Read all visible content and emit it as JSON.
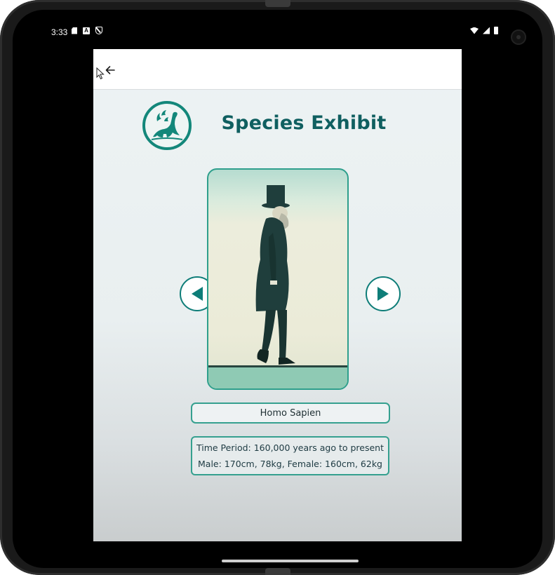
{
  "status_bar": {
    "time": "3:33",
    "left_icons": [
      "sim-card-icon",
      "a-notification-icon",
      "shield-icon"
    ],
    "right_icons": [
      "wifi-icon",
      "signal-icon",
      "battery-icon"
    ]
  },
  "app_bar": {
    "back_icon": "arrow-left-icon"
  },
  "header": {
    "logo": "dinosaur-logo-icon",
    "title": "Species Exhibit"
  },
  "exhibit": {
    "image": "walking-man-with-top-hat-illustration",
    "prev_icon": "triangle-left-icon",
    "next_icon": "triangle-right-icon",
    "species_name": "Homo Sapien",
    "time_period": "Time Period: 160,000 years ago to present",
    "size_info": "Male: 170cm, 78kg, Female: 160cm, 62kg"
  },
  "colors": {
    "accent": "#13877a",
    "title": "#0f5f60",
    "border": "#35a08f"
  }
}
